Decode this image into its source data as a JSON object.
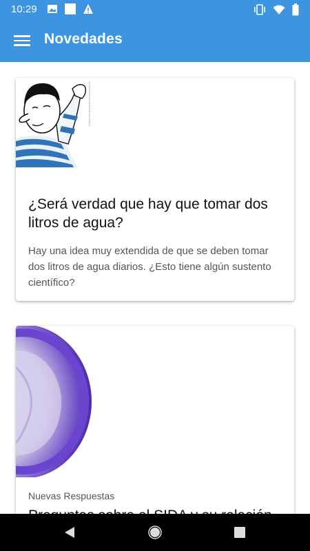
{
  "status_bar": {
    "time": "10:29",
    "left_icons": [
      "image-icon",
      "square-icon",
      "alert-icon"
    ],
    "right_icons": [
      "vibrate-icon",
      "wifi-icon",
      "battery-icon"
    ]
  },
  "app_bar": {
    "title": "Novedades",
    "menu_icon": "menu-icon",
    "background": "#3d95e2"
  },
  "cards": [
    {
      "title": "¿Será verdad que hay que tomar dos litros de agua?",
      "text": "Hay una idea muy extendida de que se deben tomar dos litros de agua diarios. ¿Esto tiene algún sustento científico?",
      "image": "cartoon-man-illustration"
    },
    {
      "label": "Nuevas Respuestas",
      "title": "Preguntas sobre el SIDA y su relación",
      "image": "purple-condom-photo"
    }
  ],
  "nav_bar": {
    "icons": [
      "back-icon",
      "home-icon",
      "recents-icon"
    ]
  }
}
